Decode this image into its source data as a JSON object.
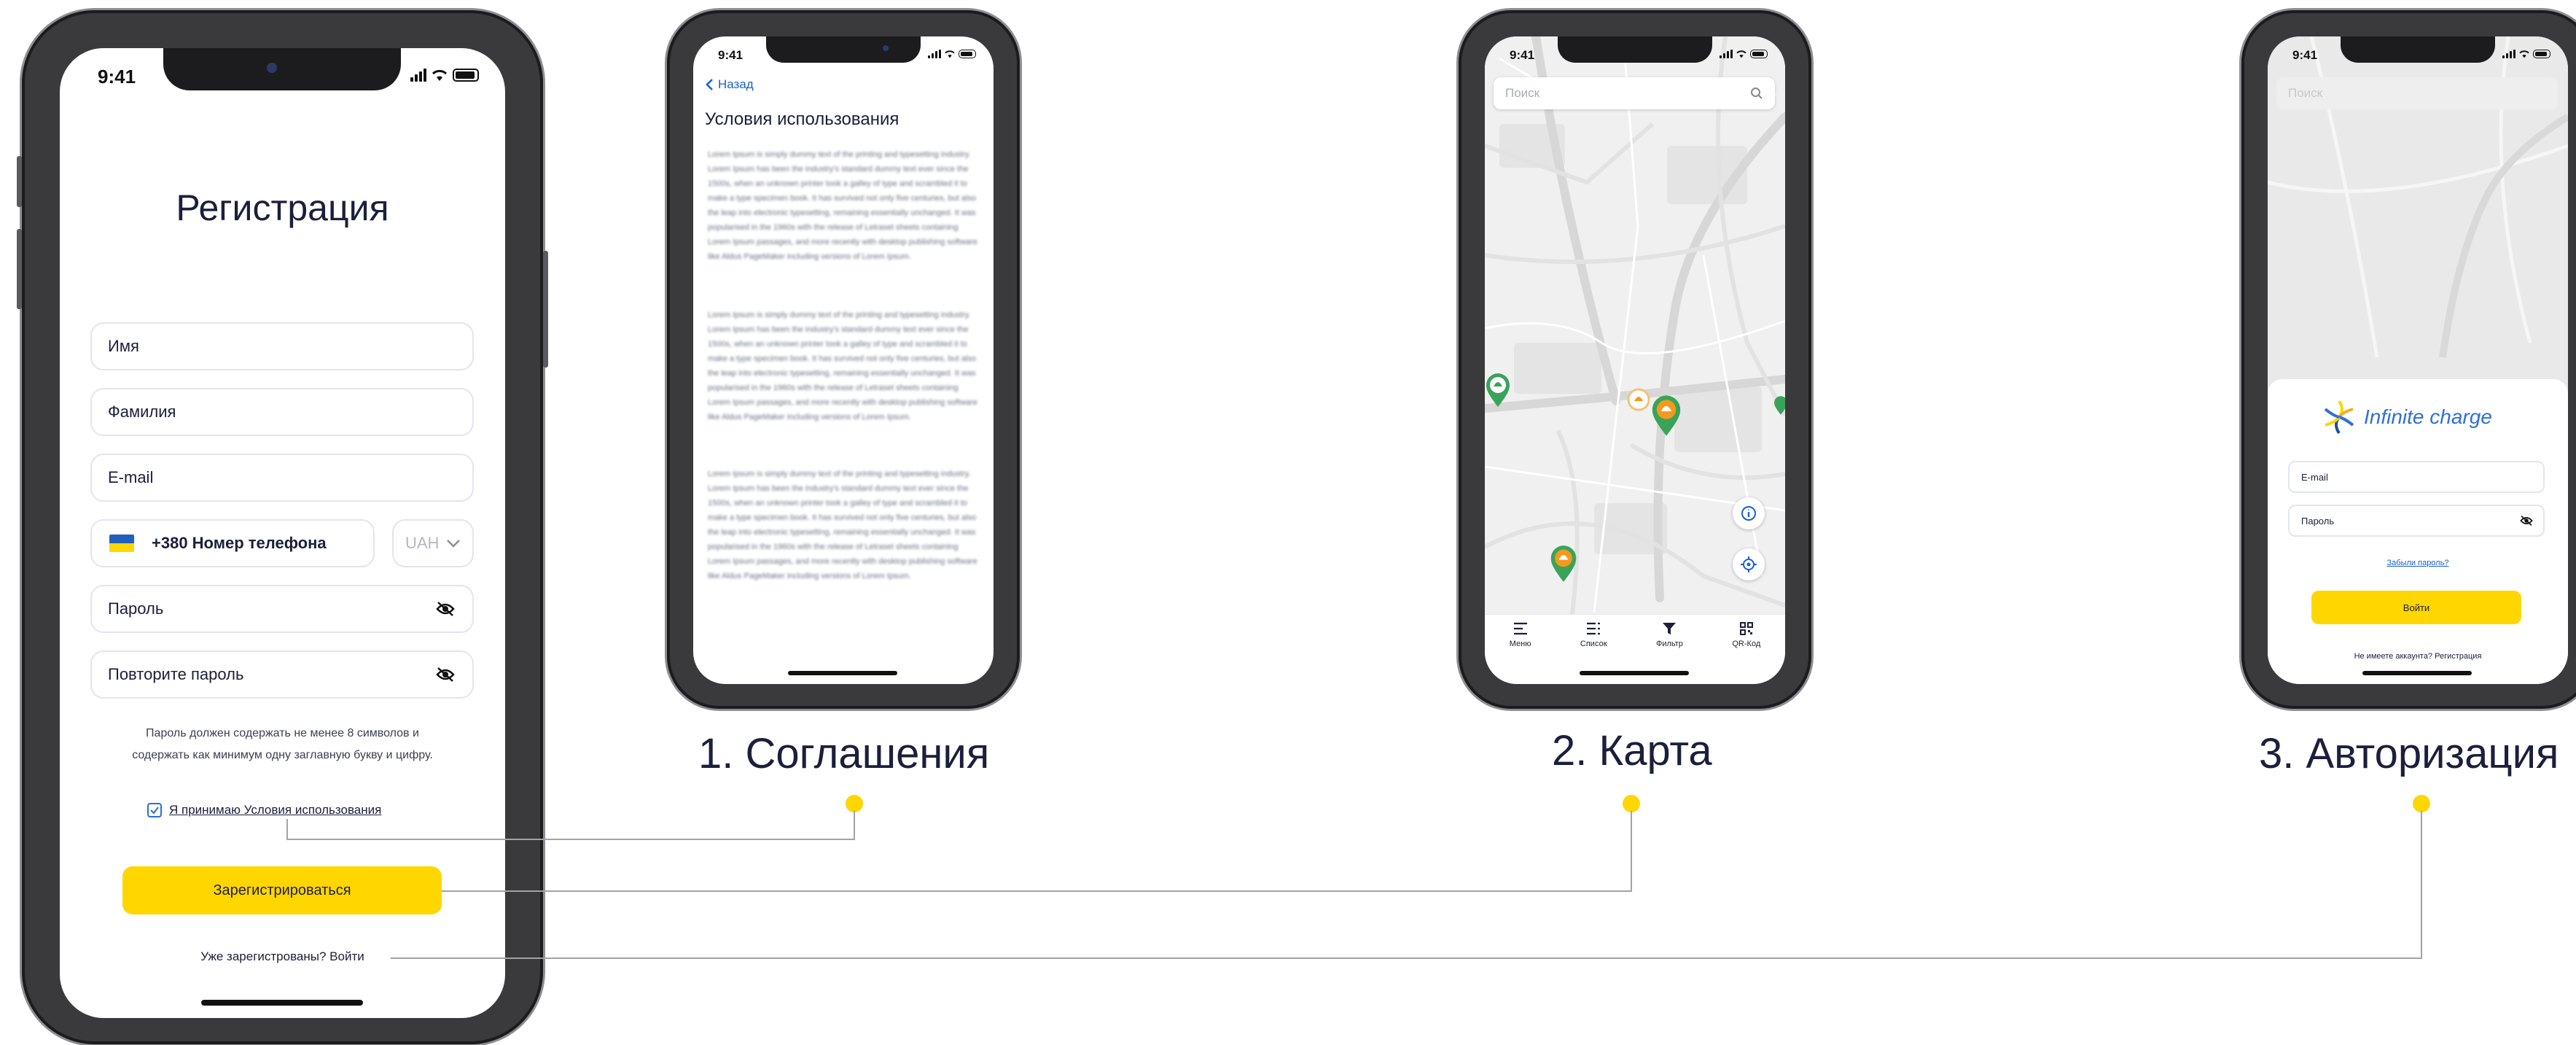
{
  "status_time": "9:41",
  "registration": {
    "title": "Регистрация",
    "first_name": "Имя",
    "last_name": "Фамилия",
    "email": "E-mail",
    "phone": "+380 Номер телефона",
    "currency": "UAH",
    "password": "Пароль",
    "repeat_password": "Повторите пароль",
    "hint_line1": "Пароль должен содержать не менее 8 символов и",
    "hint_line2": "содержать как минимум одну заглавную букву и цифру.",
    "agree": "Я принимаю Условия использования",
    "submit": "Зарегистрироваться",
    "login_prompt": "Уже зарегистрованы? Войти"
  },
  "agreement": {
    "back": "Назад",
    "title": "Условия использования",
    "paragraph": "Lorem Ipsum is simply dummy text of the printing and typesetting industry. Lorem Ipsum has been the industry's standard dummy text ever since the 1500s, when an unknown printer took a galley of type and scrambled it to make a type specimen book. It has survived not only five centuries, but also the leap into electronic typesetting, remaining essentially unchanged. It was popularised in the 1960s with the release of Letraset sheets containing Lorem Ipsum passages, and more recently with desktop publishing software like Aldus PageMaker including versions of Lorem Ipsum."
  },
  "map": {
    "search_placeholder": "Поиск",
    "tabs": [
      "Меню",
      "Список",
      "Фильтр",
      "QR-Код"
    ]
  },
  "auth": {
    "search_placeholder": "Поиск",
    "brand": "Infinite charge",
    "email": "E-mail",
    "password": "Пароль",
    "forgot": "Забыли пароль?",
    "login": "Войти",
    "no_account": "Не имеете аккаунта? Регистрация"
  },
  "captions": {
    "agreement": "1. Соглашения",
    "map": "2. Карта",
    "auth": "3. Авторизация"
  },
  "colors": {
    "accent": "#ffd600",
    "text": "#1b1f3b",
    "link": "#1a5fd0",
    "pin_green": "#3aa35a",
    "pin_orange": "#f29a1f",
    "brand_blue": "#2f6fd6"
  }
}
